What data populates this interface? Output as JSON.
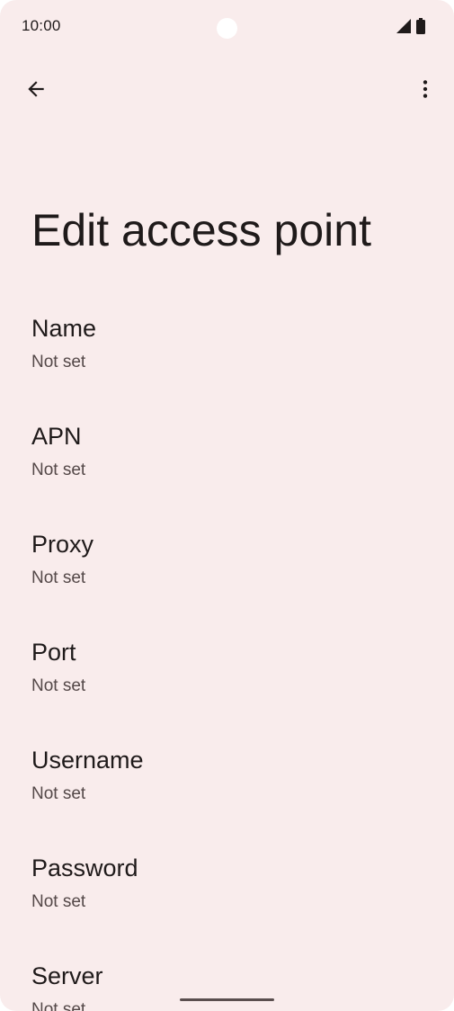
{
  "status_bar": {
    "time": "10:00",
    "icons": [
      "signal-icon",
      "battery-icon"
    ]
  },
  "app_bar": {
    "back_icon": "arrow-back-icon",
    "menu_icon": "more-vert-icon"
  },
  "page": {
    "title": "Edit access point"
  },
  "preferences": [
    {
      "title": "Name",
      "summary": "Not set"
    },
    {
      "title": "APN",
      "summary": "Not set"
    },
    {
      "title": "Proxy",
      "summary": "Not set"
    },
    {
      "title": "Port",
      "summary": "Not set"
    },
    {
      "title": "Username",
      "summary": "Not set"
    },
    {
      "title": "Password",
      "summary": "Not set"
    },
    {
      "title": "Server",
      "summary": "Not set"
    }
  ],
  "colors": {
    "background": "#f9ecec",
    "text_primary": "#1f1a1a",
    "text_secondary": "#544848"
  }
}
